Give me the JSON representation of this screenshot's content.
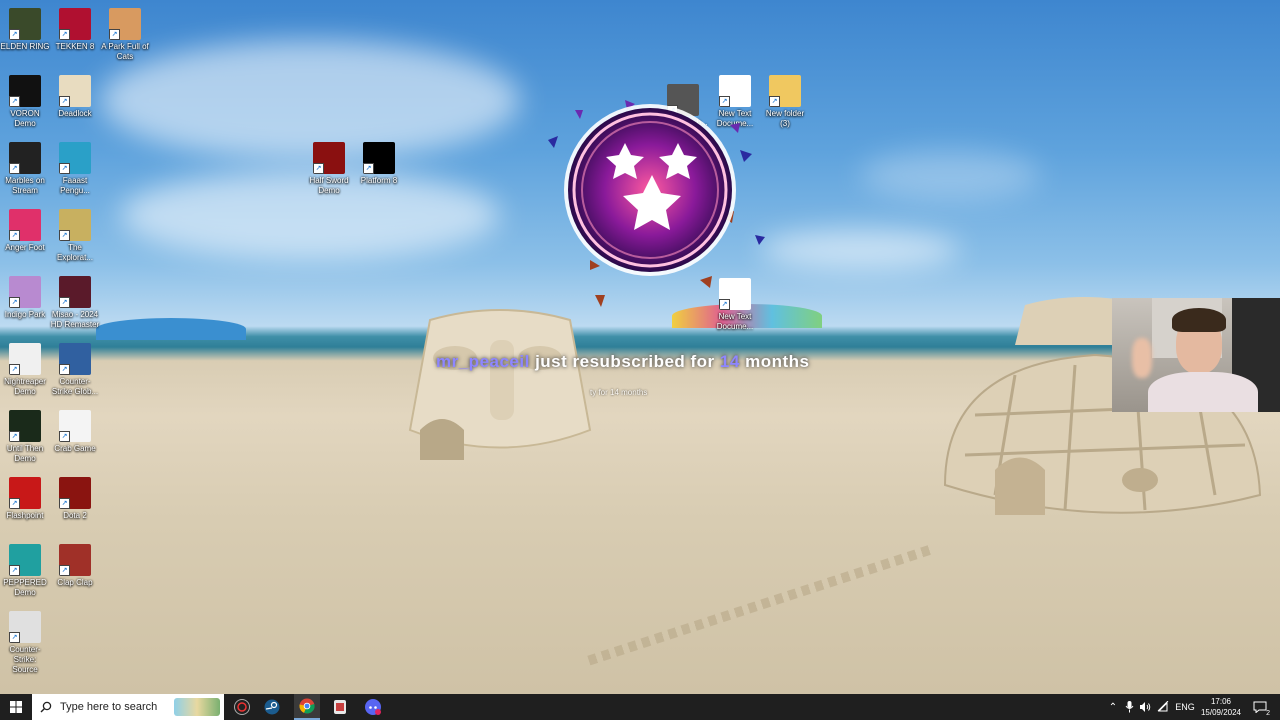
{
  "desktop": {
    "icons": [
      {
        "label": "ELDEN RING",
        "color": "#3a4a2a"
      },
      {
        "label": "TEKKEN 8",
        "color": "#b01030"
      },
      {
        "label": "A Park Full of Cats",
        "color": "#d89a60"
      },
      {
        "label": "VORON Demo",
        "color": "#111111"
      },
      {
        "label": "Deadlock",
        "color": "#e8dcc0"
      },
      {
        "label": "Marbles on Stream",
        "color": "#222222"
      },
      {
        "label": "Faaast Pengu...",
        "color": "#2aa0c8"
      },
      {
        "label": "Half Sword Demo",
        "color": "#8a1010"
      },
      {
        "label": "Platform 8",
        "color": "#000000"
      },
      {
        "label": "Anger Foot",
        "color": "#e0306a"
      },
      {
        "label": "The Explorat...",
        "color": "#c8b060"
      },
      {
        "label": "Indigo Park",
        "color": "#b88ad0"
      },
      {
        "label": "Misao - 2024 HD Remaster",
        "color": "#5a1a2a"
      },
      {
        "label": "Nightreaper Demo",
        "color": "#f0f0f0"
      },
      {
        "label": "Counter-Strike Glob...",
        "color": "#3060a0"
      },
      {
        "label": "Until Then Demo",
        "color": "#1a2a1a"
      },
      {
        "label": "Crab Game",
        "color": "#f4f4f4"
      },
      {
        "label": "Flashpoint",
        "color": "#c81818"
      },
      {
        "label": "Dota 2",
        "color": "#8a1410"
      },
      {
        "label": "PEPPERED Demo",
        "color": "#20a0a0"
      },
      {
        "label": "Clap Clap",
        "color": "#a03028"
      },
      {
        "label": "Counter-Strike: Source",
        "color": "#e0e0e0"
      },
      {
        "label": "video_playb...",
        "color": "#555555"
      },
      {
        "label": "New Text Docume...",
        "color": "#ffffff"
      },
      {
        "label": "New folder (3)",
        "color": "#f0c860"
      },
      {
        "label": "New Text Docume...",
        "color": "#ffffff"
      }
    ]
  },
  "alert": {
    "username": "mr_peaceil",
    "text_middle": "just resubscribed for",
    "months": "14",
    "text_end": "months",
    "subtext": "ty for 14 months"
  },
  "taskbar": {
    "search_placeholder": "Type here to search",
    "language": "ENG",
    "time": "17:06",
    "date": "15/09/2024",
    "notification_count": "2"
  }
}
